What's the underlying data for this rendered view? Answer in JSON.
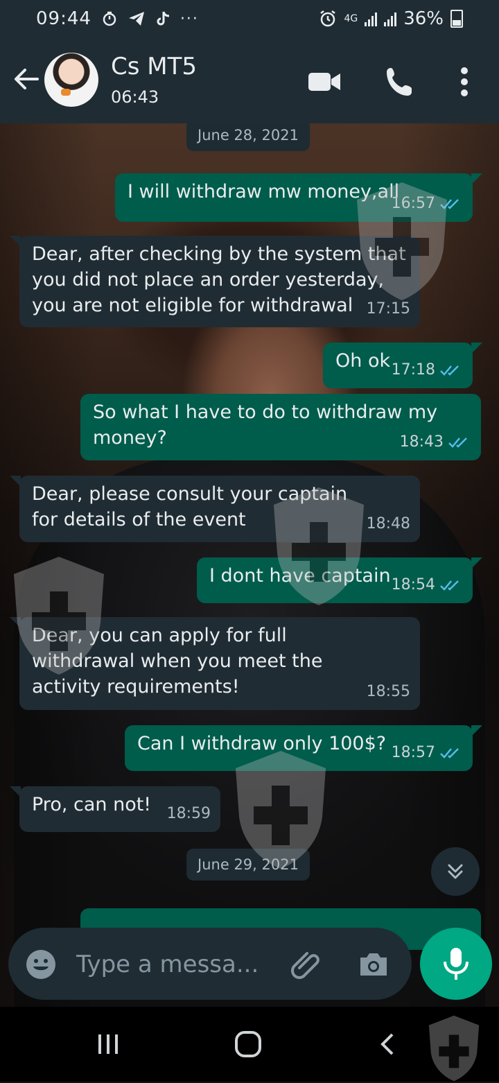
{
  "status_bar": {
    "time": "09:44",
    "network": "4G",
    "battery": "36%",
    "left_icons": [
      "timer-icon",
      "telegram-icon",
      "tiktok-icon",
      "more-notifications-icon"
    ],
    "right_icons": [
      "alarm-icon",
      "signal-icon",
      "signal-icon",
      "battery-icon"
    ]
  },
  "header": {
    "contact_name": "Cs MT5",
    "contact_status": "06:43",
    "actions": [
      "video-call-icon",
      "voice-call-icon",
      "more-options-icon"
    ]
  },
  "chat": {
    "date_chips": [
      "June 28, 2021",
      "June 29, 2021"
    ],
    "messages": [
      {
        "dir": "out",
        "text": "I will withdraw mw money,all",
        "time": "16:57",
        "status": "read"
      },
      {
        "dir": "in",
        "text": "Dear, after checking by the system that you did not place an order yesterday, you are not eligible for withdrawal",
        "time": "17:15"
      },
      {
        "dir": "out",
        "text": "Oh ok",
        "time": "17:18",
        "status": "read"
      },
      {
        "dir": "out",
        "text": "So what I have to do to withdraw my money?",
        "time": "18:43",
        "status": "read"
      },
      {
        "dir": "in",
        "text": "Dear, please consult your captain for details of the event",
        "time": "18:48"
      },
      {
        "dir": "out",
        "text": "I dont have captain",
        "time": "18:54",
        "status": "read"
      },
      {
        "dir": "in",
        "text": "Dear, you can apply for full withdrawal when you meet the activity requirements!",
        "time": "18:55"
      },
      {
        "dir": "out",
        "text": "Can I withdraw  only 100$?",
        "time": "18:57",
        "status": "read"
      },
      {
        "dir": "in",
        "text": "Pro, can not!",
        "time": "18:59"
      }
    ]
  },
  "composer": {
    "placeholder": "Type a messa..."
  },
  "colors": {
    "header_bg": "#1f2c34",
    "outgoing_bubble": "#005c4b",
    "incoming_bubble": "#202c33",
    "accent": "#00a884",
    "read_ticks": "#53bdeb"
  }
}
